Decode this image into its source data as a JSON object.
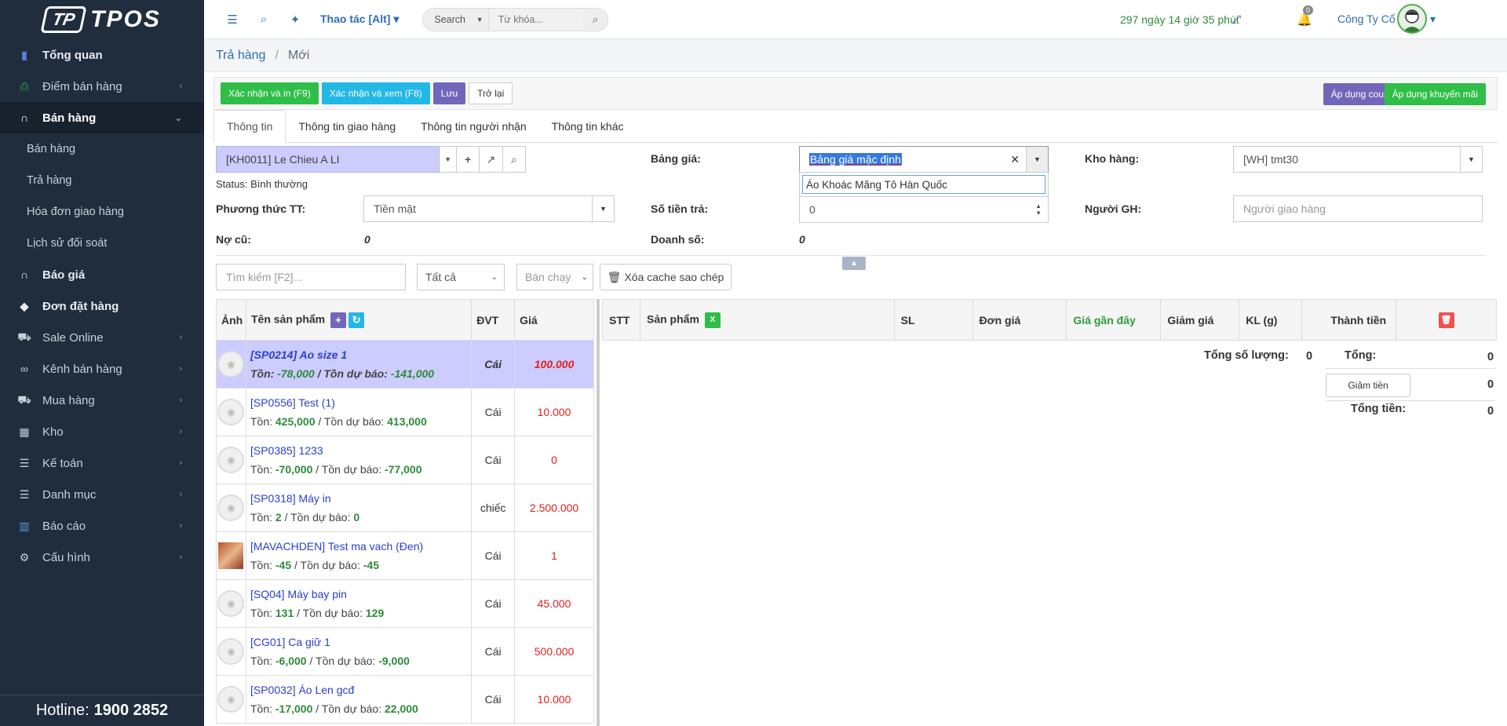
{
  "app": {
    "logo_text": "TPOS",
    "logo_mark": "TP"
  },
  "sidebar": {
    "items": [
      {
        "label": "Tổng quan",
        "icon": "bar-chart-icon"
      },
      {
        "label": "Điểm bán hàng",
        "icon": "printer-icon"
      },
      {
        "label": "Bán hàng",
        "icon": "headphones-icon"
      },
      {
        "label": "Báo giá",
        "icon": "headphones-icon"
      },
      {
        "label": "Đơn đặt hàng",
        "icon": "tag-icon"
      },
      {
        "label": "Sale Online",
        "icon": "cart-icon"
      },
      {
        "label": "Kênh bán hàng",
        "icon": "link-icon"
      },
      {
        "label": "Mua hàng",
        "icon": "cart-icon"
      },
      {
        "label": "Kho",
        "icon": "grid-icon"
      },
      {
        "label": "Kế toán",
        "icon": "list-icon"
      },
      {
        "label": "Danh mục",
        "icon": "list-icon"
      },
      {
        "label": "Báo cáo",
        "icon": "chart-icon"
      },
      {
        "label": "Cấu hình",
        "icon": "gears-icon"
      }
    ],
    "sub_items": [
      "Bán hàng",
      "Trả hàng",
      "Hóa đơn giao hàng",
      "Lịch sử đối soát"
    ],
    "hotline_label": "Hotline:",
    "hotline_number": "1900 2852"
  },
  "topbar": {
    "actions_label": "Thao tác [Alt]",
    "search_select": "Search",
    "search_placeholder": "Từ khóa...",
    "trial_text": "297 ngày 14 giờ 35 phút",
    "notification_count": "0",
    "company": "Công Ty Cổ Phầ..."
  },
  "breadcrumb": {
    "parent": "Trả hàng",
    "current": "Mới"
  },
  "buttons": {
    "confirm_print": "Xác nhận và in (F9)",
    "confirm_view": "Xác nhận và xem (F8)",
    "save": "Lưu",
    "back": "Trở lại",
    "apply_coupon": "Áp dụng coupon",
    "apply_promo": "Áp dụng khuyến mãi"
  },
  "tabs": [
    "Thông tin",
    "Thông tin giao hàng",
    "Thông tin người nhận",
    "Thông tin khác"
  ],
  "form": {
    "customer": "[KH0011] Le Chieu A LI",
    "status_label": "Status:",
    "status_value": "Bình thường",
    "payment_label": "Phương thức TT:",
    "payment_value": "Tiền mặt",
    "old_debt_label": "Nợ cũ:",
    "old_debt_value": "0",
    "pricelist_label": "Bảng giá:",
    "pricelist_value": "Bảng giá mặc định",
    "pricelist_option": "Áo Khoác Măng Tô Hàn Quốc",
    "amount_label": "Số tiền trả:",
    "amount_value": "0",
    "revenue_label": "Doanh số:",
    "revenue_value": "0",
    "warehouse_label": "Kho hàng:",
    "warehouse_value": "[WH] tmt30",
    "shipper_label": "Người GH:",
    "shipper_placeholder": "Người giao hàng"
  },
  "filters": {
    "search_placeholder": "Tìm kiếm [F2]...",
    "category": "Tất cả",
    "sort": "Bán chạy",
    "clear_cache": "Xóa cache sao chép"
  },
  "product_table": {
    "headers": [
      "Ảnh",
      "Tên sản phẩm",
      "ĐVT",
      "Giá"
    ],
    "stock_label": "Tồn:",
    "forecast_label": "/ Tồn dự báo:",
    "rows": [
      {
        "name": "[SP0214] Ao size 1",
        "stock": "-78,000",
        "forecast": "-141,000",
        "unit": "Cái",
        "price": "100.000"
      },
      {
        "name": "[SP0556] Test (1)",
        "stock": "425,000",
        "forecast": "413,000",
        "unit": "Cái",
        "price": "10.000"
      },
      {
        "name": "[SP0385] 1233",
        "stock": "-70,000",
        "forecast": "-77,000",
        "unit": "Cái",
        "price": "0"
      },
      {
        "name": "[SP0318] Máy in",
        "stock": "2",
        "forecast": "0",
        "unit": "chiếc",
        "price": "2.500.000"
      },
      {
        "name": "[MAVACHDEN] Test ma vach (Đen)",
        "stock": "-45",
        "forecast": "-45",
        "unit": "Cái",
        "price": "1"
      },
      {
        "name": "[SQ04] Máy bay pin",
        "stock": "131",
        "forecast": "129",
        "unit": "Cái",
        "price": "45.000"
      },
      {
        "name": "[CG01] Ca giữ 1",
        "stock": "-6,000",
        "forecast": "-9,000",
        "unit": "Cái",
        "price": "500.000"
      },
      {
        "name": "[SP0032] Áo Len gcđ",
        "stock": "-17,000",
        "forecast": "22,000",
        "unit": "Cái",
        "price": "10.000"
      }
    ]
  },
  "order_table": {
    "headers": [
      "STT",
      "Sản phẩm",
      "SL",
      "Đơn giá",
      "Giá gần đây",
      "Giảm giá",
      "KL (g)",
      "Thành tiền"
    ]
  },
  "summary": {
    "total_qty_label": "Tổng số lượng:",
    "total_qty": "0",
    "total_label": "Tổng:",
    "total": "0",
    "discount_button": "Giảm tiền",
    "discount": "0",
    "grand_total_label": "Tổng tiền:",
    "grand_total": "0"
  }
}
